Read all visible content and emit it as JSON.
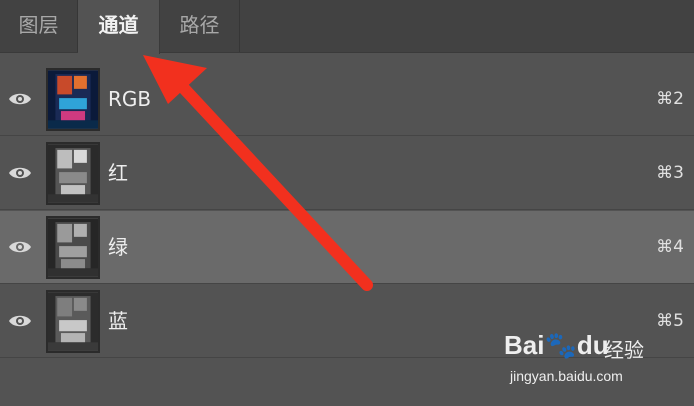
{
  "tabs": [
    {
      "label": "图层"
    },
    {
      "label": "通道"
    },
    {
      "label": "路径"
    }
  ],
  "active_tab": "通道",
  "channels": [
    {
      "name": "RGB",
      "shortcut": "⌘2",
      "visible": true,
      "selected": false,
      "thumb": "color"
    },
    {
      "name": "红",
      "shortcut": "⌘3",
      "visible": true,
      "selected": false,
      "thumb": "gray-light"
    },
    {
      "name": "绿",
      "shortcut": "⌘4",
      "visible": true,
      "selected": true,
      "thumb": "gray-mid"
    },
    {
      "name": "蓝",
      "shortcut": "⌘5",
      "visible": true,
      "selected": false,
      "thumb": "gray-dark"
    }
  ],
  "icons": {
    "visibility": "eye-icon"
  },
  "watermark": {
    "logo": "Bai🐾du",
    "cn": "经验",
    "url": "jingyan.baidu.com"
  },
  "colors": {
    "arrow": "#f2301e",
    "panel": "#535353",
    "tabbar": "#424242",
    "selected_row": "#6a6a6a"
  }
}
